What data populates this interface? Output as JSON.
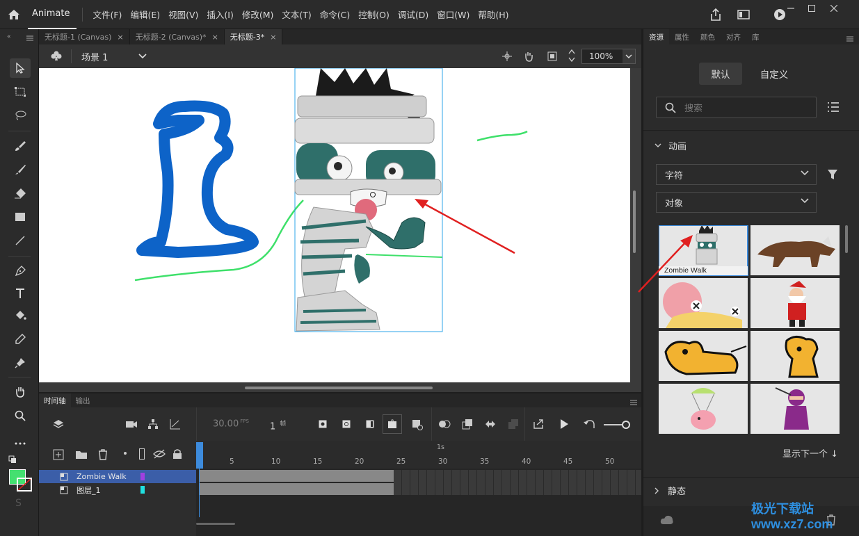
{
  "app": {
    "name": "Animate"
  },
  "menu": [
    "文件(F)",
    "编辑(E)",
    "视图(V)",
    "插入(I)",
    "修改(M)",
    "文本(T)",
    "命令(C)",
    "控制(O)",
    "调试(D)",
    "窗口(W)",
    "帮助(H)"
  ],
  "doc_tabs": [
    {
      "label": "无标题-1 (Canvas)"
    },
    {
      "label": "无标题-2 (Canvas)*"
    },
    {
      "label": "无标题-3*"
    }
  ],
  "stage_bar": {
    "scene": "场景 1",
    "zoom": "100%"
  },
  "timeline": {
    "tabs": [
      "时间轴",
      "输出"
    ],
    "fps": "30.00",
    "fps_unit": "FPS",
    "frame": "1",
    "frame_unit": "帧",
    "second_marker": "1s",
    "ruler": [
      "5",
      "10",
      "15",
      "20",
      "25",
      "30",
      "35",
      "40",
      "45",
      "50"
    ],
    "layers": [
      {
        "name": "Zombie Walk",
        "color": "#a040e0"
      },
      {
        "name": "图层_1",
        "color": "#20e0e0"
      }
    ]
  },
  "right_panel": {
    "tabs": [
      "资源",
      "属性",
      "颜色",
      "对齐",
      "库"
    ],
    "seg_default": "默认",
    "seg_custom": "自定义",
    "search_placeholder": "搜索",
    "section_animation": "动画",
    "dropdown_character": "字符",
    "dropdown_object": "对象",
    "selected_asset_label": "Zombie Walk",
    "show_next": "显示下一个 ↓",
    "section_static": "静态"
  },
  "colors": {
    "fill": "#44e070",
    "accent": "#3d8bdc",
    "arrow": "#e02020"
  },
  "watermark": "极光下载站 www.xz7.com"
}
